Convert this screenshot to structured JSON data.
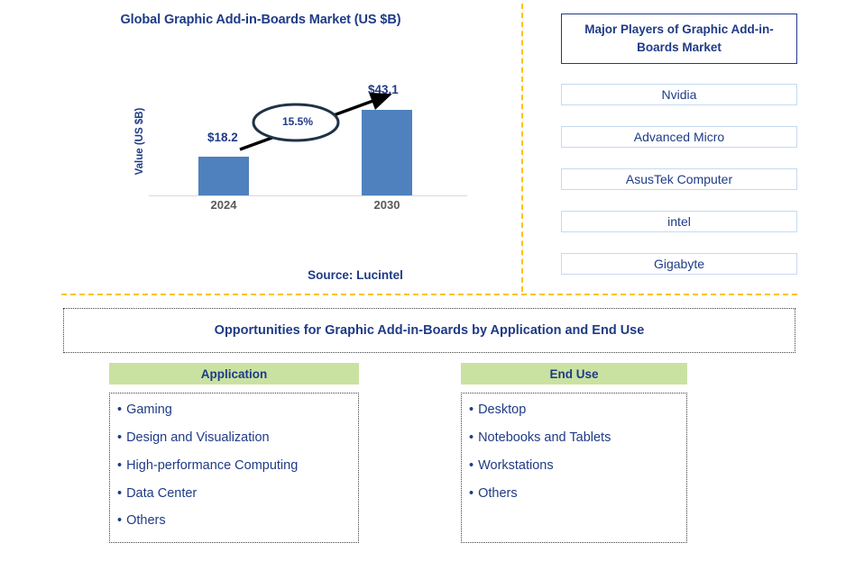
{
  "chart_data": {
    "type": "bar",
    "title": "Global Graphic Add-in-Boards Market (US $B)",
    "ylabel": "Value (US $B)",
    "xlabel": "",
    "categories": [
      "2024",
      "2030"
    ],
    "values": [
      18.2,
      43.1
    ],
    "value_labels": [
      "$18.2",
      "$43.1"
    ],
    "ylim": [
      0,
      48
    ],
    "grid": false,
    "legend": "none",
    "annotation": "15.5%",
    "annotation_type": "cagr-ellipse-arrow",
    "bar_color": "#4E81BD",
    "source": "Source: Lucintel"
  },
  "chart_panel": {
    "title": "Global Graphic Add-in-Boards Market (US $B)",
    "y_axis_label": "Value (US $B)",
    "cagr": "15.5%",
    "source": "Source: Lucintel",
    "bars": [
      {
        "label": "2024",
        "value_label": "$18.2"
      },
      {
        "label": "2030",
        "value_label": "$43.1"
      }
    ]
  },
  "players_panel": {
    "header": "Major Players of Graphic Add-in-Boards Market",
    "items": [
      {
        "name": "Nvidia"
      },
      {
        "name": "Advanced Micro"
      },
      {
        "name": "AsusTek Computer"
      },
      {
        "name": "intel"
      },
      {
        "name": "Gigabyte"
      }
    ]
  },
  "opportunities": {
    "banner": "Opportunities for Graphic Add-in-Boards by Application and End Use",
    "columns": [
      {
        "header": "Application",
        "bullet": "•",
        "items": [
          "Gaming",
          "Design and Visualization",
          "High-performance Computing",
          "Data Center",
          "Others"
        ]
      },
      {
        "header": "End Use",
        "bullet": "•",
        "items": [
          "Desktop",
          "Notebooks and Tablets",
          "Workstations",
          "Others"
        ]
      }
    ]
  },
  "colors": {
    "navy": "#1F3B86",
    "bar_blue": "#4E81BD",
    "divider_gold": "#FFC20E",
    "header_green": "#C9E2A1",
    "row_border": "#C5D9F1"
  }
}
